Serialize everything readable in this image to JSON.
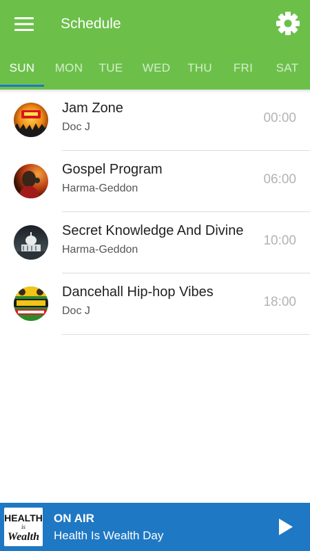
{
  "header": {
    "title": "Schedule",
    "menu_icon": "hamburger-menu-icon",
    "settings_icon": "gear-icon",
    "background_color": "#6cc04a"
  },
  "tabs": [
    {
      "label": "SUN",
      "active": true
    },
    {
      "label": "MON",
      "active": false
    },
    {
      "label": "TUE",
      "active": false
    },
    {
      "label": "WED",
      "active": false
    },
    {
      "label": "THU",
      "active": false
    },
    {
      "label": "FRI",
      "active": false
    },
    {
      "label": "SAT",
      "active": false
    }
  ],
  "tab_indicator_color": "#1a77c9",
  "schedule": [
    {
      "title": "Jam Zone",
      "host": "Doc J",
      "time": "00:00",
      "artwork": "jam-zone-artwork"
    },
    {
      "title": "Gospel Program",
      "host": "Harma-Geddon",
      "time": "06:00",
      "artwork": "gospel-program-artwork"
    },
    {
      "title": "Secret Knowledge And Divine",
      "host": "Harma-Geddon",
      "time": "10:00",
      "artwork": "secret-knowledge-artwork"
    },
    {
      "title": "Dancehall Hip-hop Vibes",
      "host": "Doc J",
      "time": "18:00",
      "artwork": "dancehall-vibes-artwork"
    }
  ],
  "player": {
    "label": "ON AIR",
    "show": "Health Is Wealth Day",
    "play_icon": "play-icon",
    "background_color": "#1f78c3",
    "artwork_text": {
      "line1": "HEALTH",
      "line2": "is",
      "line3": "Wealth"
    }
  }
}
